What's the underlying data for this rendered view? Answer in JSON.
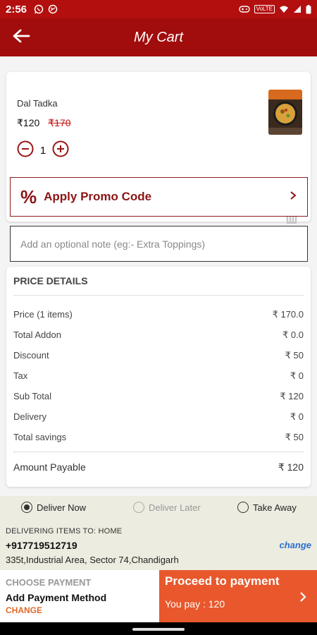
{
  "status_bar": {
    "time": "2:56",
    "network_label": "VoLTE"
  },
  "app_bar": {
    "title": "My Cart"
  },
  "cart_item": {
    "name": "Dal Tadka",
    "price": "₹120",
    "original_price": "₹170",
    "quantity": "1"
  },
  "promo": {
    "icon_text": "%",
    "label": "Apply Promo Code"
  },
  "note": {
    "placeholder": "Add an optional note (eg:- Extra Toppings)"
  },
  "price_details": {
    "title": "PRICE DETAILS",
    "rows": [
      {
        "label": "Price (1 items)",
        "value": "₹ 170.0"
      },
      {
        "label": "Total Addon",
        "value": "₹ 0.0"
      },
      {
        "label": "Discount",
        "value": "₹ 50"
      },
      {
        "label": "Tax",
        "value": "₹ 0"
      },
      {
        "label": "Sub Total",
        "value": "₹ 120"
      },
      {
        "label": "Delivery",
        "value": "₹ 0"
      },
      {
        "label": "Total savings",
        "value": "₹ 50"
      }
    ],
    "total_label": "Amount Payable",
    "total_value": "₹ 120"
  },
  "delivery": {
    "options": [
      {
        "label": "Deliver Now",
        "selected": true,
        "enabled": true
      },
      {
        "label": "Deliver Later",
        "selected": false,
        "enabled": false
      },
      {
        "label": "Take Away",
        "selected": false,
        "enabled": true
      }
    ],
    "delivering_to": "DELIVERING ITEMS TO: HOME",
    "phone": "+917719512719",
    "change_label": "change",
    "address": "335t,Industrial Area,  Sector 74,Chandigarh"
  },
  "payment": {
    "choose_title": "CHOOSE PAYMENT",
    "method": "Add Payment Method",
    "change_label": "CHANGE",
    "proceed_label": "Proceed to payment",
    "you_pay": "You pay : 120"
  },
  "colors": {
    "status_bar": "#b30f0f",
    "app_bar": "#a10d0d",
    "promo_accent": "#8c1414",
    "proceed_bg": "#e8582c",
    "link_blue": "#2a6fcf"
  }
}
